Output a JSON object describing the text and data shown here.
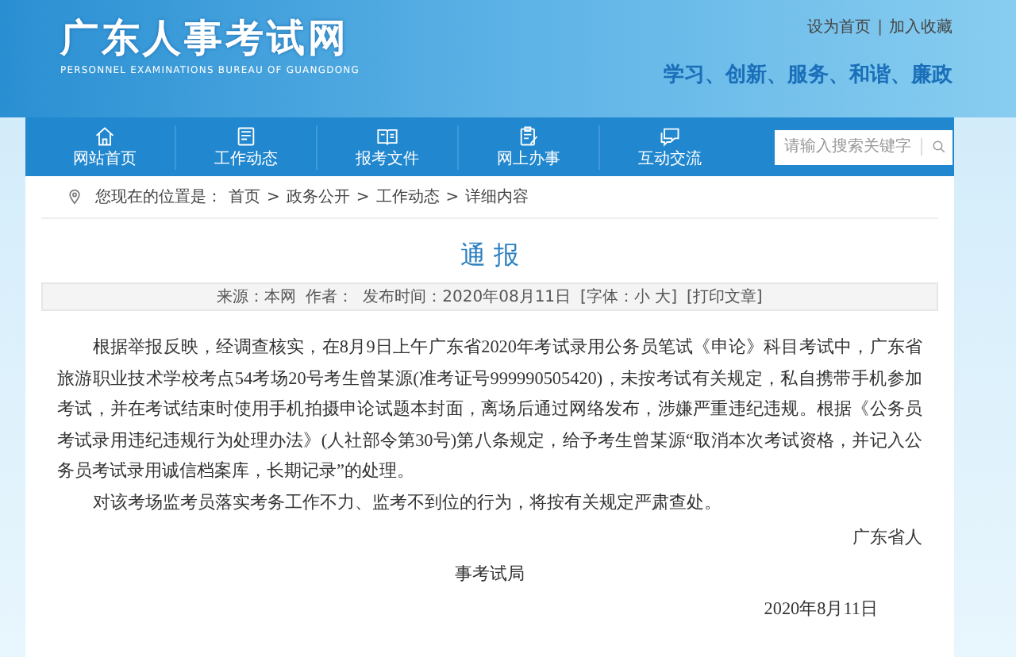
{
  "header": {
    "site_title": "广东人事考试网",
    "site_subtitle": "PERSONNEL EXAMINATIONS BUREAU OF GUANGDONG",
    "top_links": [
      "设为首页",
      "加入收藏"
    ],
    "top_link_separator": "|",
    "slogan": "学习、创新、服务、和谐、廉政"
  },
  "nav": {
    "items": [
      {
        "label": "网站首页"
      },
      {
        "label": "工作动态"
      },
      {
        "label": "报考文件"
      },
      {
        "label": "网上办事"
      },
      {
        "label": "互动交流"
      }
    ],
    "search": {
      "placeholder": "请输入搜索关键字"
    }
  },
  "breadcrumb": {
    "label": "您现在的位置是：",
    "separator": ">",
    "items": [
      "首页",
      "政务公开",
      "工作动态",
      "详细内容"
    ]
  },
  "article": {
    "title": "通 报",
    "meta": [
      "来源：本网",
      "作者：",
      "发布时间：2020年08月11日",
      "[字体：小 大]",
      "[打印文章]"
    ],
    "paragraphs": [
      "根据举报反映，经调查核实，在8月9日上午广东省2020年考试录用公务员笔试《申论》科目考试中，广东省旅游职业技术学校考点54考场20号考生曾某源(准考证号999990505420)，未按考试有关规定，私自携带手机参加考试，并在考试结束时使用手机拍摄申论试题本封面，离场后通过网络发布，涉嫌严重违纪违规。根据《公务员考试录用违纪违规行为处理办法》(人社部令第30号)第八条规定，给予考生曾某源“取消本次考试资格，并记入公务员考试录用诚信档案库，长期记录”的处理。",
      "对该考场监考员落实考务工作不力、监考不到位的行为，将按有关规定严肃查处。"
    ],
    "signature": [
      "广东省人",
      "事考试局"
    ],
    "date": "2020年8月11日"
  }
}
